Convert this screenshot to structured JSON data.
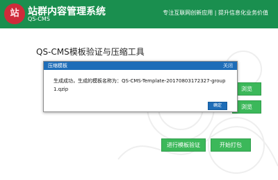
{
  "header": {
    "logo_glyph": "站",
    "title": "站群内容管理系统",
    "subtitle": "QS-CMS",
    "slogan": "专注互联网创新应用 | 提升信息化业务价值"
  },
  "main": {
    "tool_title": "QS-CMS模板验证与压缩工具",
    "browse_label_1": "浏览",
    "browse_label_2": "浏览",
    "verify_button": "进行模板验证",
    "pack_button": "开始打包"
  },
  "dialog": {
    "title": "压缩模板",
    "close_label": "关闭",
    "message": "生成成功，生成的模板名称为：QS-CMS-Template-20170803172327-group1.qzip",
    "ok_label": "确定"
  },
  "colors": {
    "header_green": "#1a8f4f",
    "button_green": "#3cb85a",
    "dialog_blue": "#1e6db8",
    "logo_red": "#cf2b3a"
  }
}
